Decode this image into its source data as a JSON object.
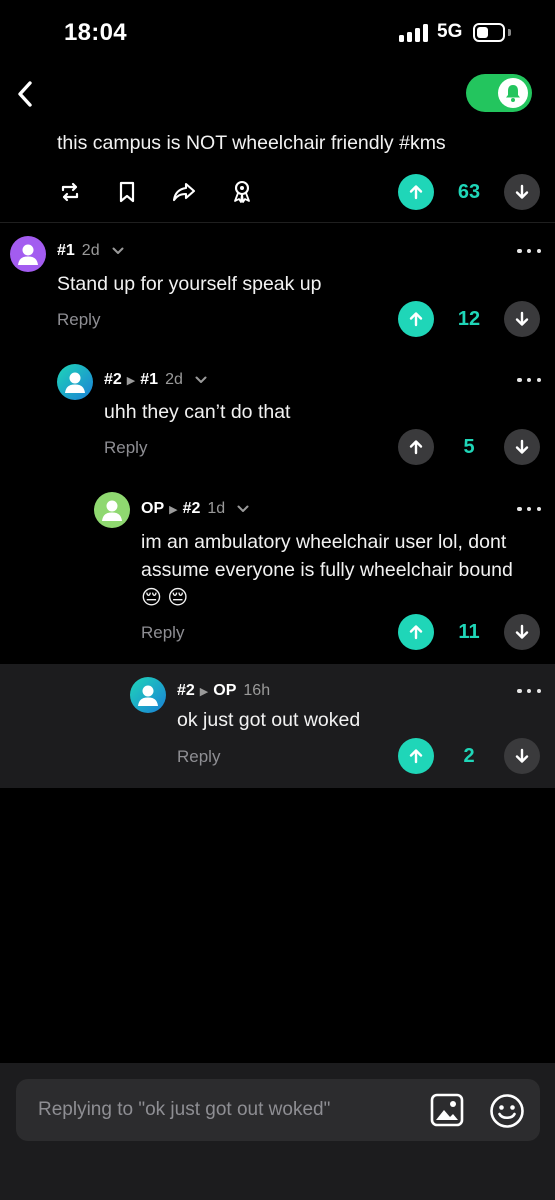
{
  "status_bar": {
    "time": "18:04",
    "network": "5G"
  },
  "post": {
    "text": "this campus is NOT wheelchair friendly #kms",
    "vote_count": "63"
  },
  "comments": [
    {
      "handle": "#1",
      "reply_to": "",
      "time": "2d",
      "text": "Stand up for yourself speak up",
      "reply_label": "Reply",
      "vote_count": "12",
      "upvoted": true
    },
    {
      "handle": "#2",
      "reply_to": "#1",
      "time": "2d",
      "text": "uhh they can’t do that",
      "reply_label": "Reply",
      "vote_count": "5",
      "upvoted": false
    },
    {
      "handle": "OP",
      "reply_to": "#2",
      "time": "1d",
      "text_line1": "im an ambulatory wheelchair user lol, dont",
      "text_line2": "assume everyone is fully wheelchair bound",
      "emojis": "😔 😔",
      "reply_label": "Reply",
      "vote_count": "11",
      "upvoted": true
    },
    {
      "handle": "#2",
      "reply_to": "OP",
      "time": "16h",
      "text": "ok just got out woked",
      "reply_label": "Reply",
      "vote_count": "2",
      "upvoted": true
    }
  ],
  "composer": {
    "placeholder": "Replying to \"ok just got out woked\""
  },
  "colors": {
    "accent": "#1fd6b8",
    "toggle": "#23c55e",
    "avatar_purple": "#a35cf0",
    "avatar_teal": "#19c2b0",
    "avatar_green": "#8fd870"
  },
  "icons": [
    "back-icon",
    "bell-icon",
    "repost-icon",
    "bookmark-icon",
    "share-icon",
    "award-icon",
    "upvote-icon",
    "downvote-icon",
    "more-icon",
    "chevron-down-icon",
    "image-icon",
    "emoji-icon"
  ]
}
